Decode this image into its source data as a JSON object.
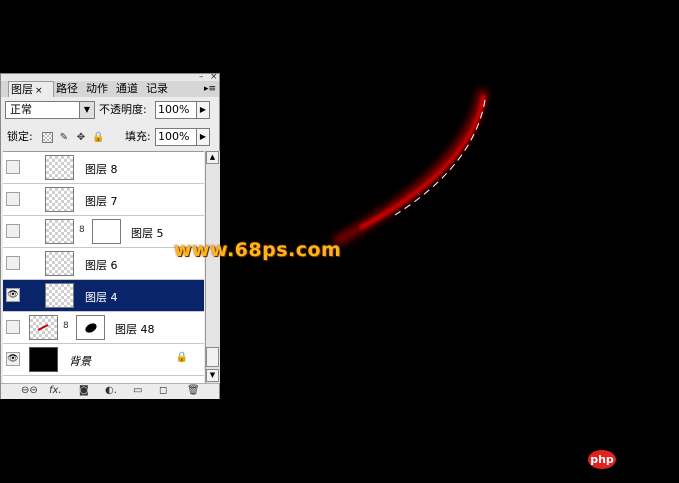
{
  "panel": {
    "tabs": [
      "图层",
      "路径",
      "动作",
      "通道",
      "记录"
    ],
    "close_glyph": "×",
    "menu_glyph": "▸≡",
    "blend_mode": "正常",
    "opacity_label": "不透明度:",
    "opacity_value": "100%",
    "lock_label": "锁定:",
    "fill_label": "填充:",
    "fill_value": "100%"
  },
  "layers": [
    {
      "name": "图层 8",
      "visible": false,
      "selected": false,
      "has_mask": false,
      "italic": false
    },
    {
      "name": "图层 7",
      "visible": false,
      "selected": false,
      "has_mask": false,
      "italic": false
    },
    {
      "name": "图层 5",
      "visible": false,
      "selected": false,
      "has_mask": true,
      "italic": false
    },
    {
      "name": "图层 6",
      "visible": false,
      "selected": false,
      "has_mask": false,
      "italic": false
    },
    {
      "name": "图层 4",
      "visible": true,
      "selected": true,
      "has_mask": false,
      "italic": false
    },
    {
      "name": "图层 48",
      "visible": false,
      "selected": false,
      "has_mask": true,
      "italic": false
    },
    {
      "name": "背景",
      "visible": true,
      "selected": false,
      "has_mask": false,
      "italic": true
    }
  ],
  "bottom_icons": [
    "link-icon",
    "fx-icon",
    "mask-icon",
    "adjustment-icon",
    "folder-icon",
    "new-layer-icon",
    "trash-icon"
  ],
  "watermark": "www.68ps.com",
  "badge": "php",
  "colors": {
    "accent_glow": "#c00000",
    "selection": "#0a246a",
    "watermark": "#ffb41a"
  }
}
